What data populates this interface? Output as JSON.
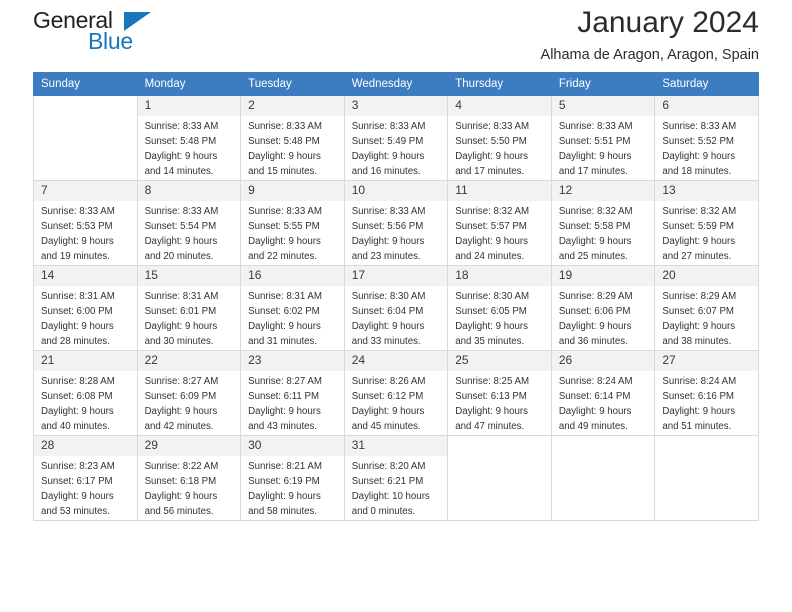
{
  "brand": {
    "name_part1": "General",
    "name_part2": "Blue",
    "accent_color": "#1b75bb",
    "flag_icon": "triangle-flag-icon"
  },
  "header": {
    "month_title": "January 2024",
    "location": "Alhama de Aragon, Aragon, Spain"
  },
  "calendar": {
    "header_bg": "#3b7dc0",
    "daynum_bg": "#f2f2f2",
    "weekday_headers": [
      "Sunday",
      "Monday",
      "Tuesday",
      "Wednesday",
      "Thursday",
      "Friday",
      "Saturday"
    ],
    "weeks": [
      [
        {
          "day": "",
          "empty": true,
          "sunrise": "",
          "sunset": "",
          "daylight_1": "",
          "daylight_2": ""
        },
        {
          "day": "1",
          "sunrise": "Sunrise: 8:33 AM",
          "sunset": "Sunset: 5:48 PM",
          "daylight_1": "Daylight: 9 hours",
          "daylight_2": "and 14 minutes."
        },
        {
          "day": "2",
          "sunrise": "Sunrise: 8:33 AM",
          "sunset": "Sunset: 5:48 PM",
          "daylight_1": "Daylight: 9 hours",
          "daylight_2": "and 15 minutes."
        },
        {
          "day": "3",
          "sunrise": "Sunrise: 8:33 AM",
          "sunset": "Sunset: 5:49 PM",
          "daylight_1": "Daylight: 9 hours",
          "daylight_2": "and 16 minutes."
        },
        {
          "day": "4",
          "sunrise": "Sunrise: 8:33 AM",
          "sunset": "Sunset: 5:50 PM",
          "daylight_1": "Daylight: 9 hours",
          "daylight_2": "and 17 minutes."
        },
        {
          "day": "5",
          "sunrise": "Sunrise: 8:33 AM",
          "sunset": "Sunset: 5:51 PM",
          "daylight_1": "Daylight: 9 hours",
          "daylight_2": "and 17 minutes."
        },
        {
          "day": "6",
          "sunrise": "Sunrise: 8:33 AM",
          "sunset": "Sunset: 5:52 PM",
          "daylight_1": "Daylight: 9 hours",
          "daylight_2": "and 18 minutes."
        }
      ],
      [
        {
          "day": "7",
          "sunrise": "Sunrise: 8:33 AM",
          "sunset": "Sunset: 5:53 PM",
          "daylight_1": "Daylight: 9 hours",
          "daylight_2": "and 19 minutes."
        },
        {
          "day": "8",
          "sunrise": "Sunrise: 8:33 AM",
          "sunset": "Sunset: 5:54 PM",
          "daylight_1": "Daylight: 9 hours",
          "daylight_2": "and 20 minutes."
        },
        {
          "day": "9",
          "sunrise": "Sunrise: 8:33 AM",
          "sunset": "Sunset: 5:55 PM",
          "daylight_1": "Daylight: 9 hours",
          "daylight_2": "and 22 minutes."
        },
        {
          "day": "10",
          "sunrise": "Sunrise: 8:33 AM",
          "sunset": "Sunset: 5:56 PM",
          "daylight_1": "Daylight: 9 hours",
          "daylight_2": "and 23 minutes."
        },
        {
          "day": "11",
          "sunrise": "Sunrise: 8:32 AM",
          "sunset": "Sunset: 5:57 PM",
          "daylight_1": "Daylight: 9 hours",
          "daylight_2": "and 24 minutes."
        },
        {
          "day": "12",
          "sunrise": "Sunrise: 8:32 AM",
          "sunset": "Sunset: 5:58 PM",
          "daylight_1": "Daylight: 9 hours",
          "daylight_2": "and 25 minutes."
        },
        {
          "day": "13",
          "sunrise": "Sunrise: 8:32 AM",
          "sunset": "Sunset: 5:59 PM",
          "daylight_1": "Daylight: 9 hours",
          "daylight_2": "and 27 minutes."
        }
      ],
      [
        {
          "day": "14",
          "sunrise": "Sunrise: 8:31 AM",
          "sunset": "Sunset: 6:00 PM",
          "daylight_1": "Daylight: 9 hours",
          "daylight_2": "and 28 minutes."
        },
        {
          "day": "15",
          "sunrise": "Sunrise: 8:31 AM",
          "sunset": "Sunset: 6:01 PM",
          "daylight_1": "Daylight: 9 hours",
          "daylight_2": "and 30 minutes."
        },
        {
          "day": "16",
          "sunrise": "Sunrise: 8:31 AM",
          "sunset": "Sunset: 6:02 PM",
          "daylight_1": "Daylight: 9 hours",
          "daylight_2": "and 31 minutes."
        },
        {
          "day": "17",
          "sunrise": "Sunrise: 8:30 AM",
          "sunset": "Sunset: 6:04 PM",
          "daylight_1": "Daylight: 9 hours",
          "daylight_2": "and 33 minutes."
        },
        {
          "day": "18",
          "sunrise": "Sunrise: 8:30 AM",
          "sunset": "Sunset: 6:05 PM",
          "daylight_1": "Daylight: 9 hours",
          "daylight_2": "and 35 minutes."
        },
        {
          "day": "19",
          "sunrise": "Sunrise: 8:29 AM",
          "sunset": "Sunset: 6:06 PM",
          "daylight_1": "Daylight: 9 hours",
          "daylight_2": "and 36 minutes."
        },
        {
          "day": "20",
          "sunrise": "Sunrise: 8:29 AM",
          "sunset": "Sunset: 6:07 PM",
          "daylight_1": "Daylight: 9 hours",
          "daylight_2": "and 38 minutes."
        }
      ],
      [
        {
          "day": "21",
          "sunrise": "Sunrise: 8:28 AM",
          "sunset": "Sunset: 6:08 PM",
          "daylight_1": "Daylight: 9 hours",
          "daylight_2": "and 40 minutes."
        },
        {
          "day": "22",
          "sunrise": "Sunrise: 8:27 AM",
          "sunset": "Sunset: 6:09 PM",
          "daylight_1": "Daylight: 9 hours",
          "daylight_2": "and 42 minutes."
        },
        {
          "day": "23",
          "sunrise": "Sunrise: 8:27 AM",
          "sunset": "Sunset: 6:11 PM",
          "daylight_1": "Daylight: 9 hours",
          "daylight_2": "and 43 minutes."
        },
        {
          "day": "24",
          "sunrise": "Sunrise: 8:26 AM",
          "sunset": "Sunset: 6:12 PM",
          "daylight_1": "Daylight: 9 hours",
          "daylight_2": "and 45 minutes."
        },
        {
          "day": "25",
          "sunrise": "Sunrise: 8:25 AM",
          "sunset": "Sunset: 6:13 PM",
          "daylight_1": "Daylight: 9 hours",
          "daylight_2": "and 47 minutes."
        },
        {
          "day": "26",
          "sunrise": "Sunrise: 8:24 AM",
          "sunset": "Sunset: 6:14 PM",
          "daylight_1": "Daylight: 9 hours",
          "daylight_2": "and 49 minutes."
        },
        {
          "day": "27",
          "sunrise": "Sunrise: 8:24 AM",
          "sunset": "Sunset: 6:16 PM",
          "daylight_1": "Daylight: 9 hours",
          "daylight_2": "and 51 minutes."
        }
      ],
      [
        {
          "day": "28",
          "sunrise": "Sunrise: 8:23 AM",
          "sunset": "Sunset: 6:17 PM",
          "daylight_1": "Daylight: 9 hours",
          "daylight_2": "and 53 minutes."
        },
        {
          "day": "29",
          "sunrise": "Sunrise: 8:22 AM",
          "sunset": "Sunset: 6:18 PM",
          "daylight_1": "Daylight: 9 hours",
          "daylight_2": "and 56 minutes."
        },
        {
          "day": "30",
          "sunrise": "Sunrise: 8:21 AM",
          "sunset": "Sunset: 6:19 PM",
          "daylight_1": "Daylight: 9 hours",
          "daylight_2": "and 58 minutes."
        },
        {
          "day": "31",
          "sunrise": "Sunrise: 8:20 AM",
          "sunset": "Sunset: 6:21 PM",
          "daylight_1": "Daylight: 10 hours",
          "daylight_2": "and 0 minutes."
        },
        {
          "day": "",
          "empty": true,
          "sunrise": "",
          "sunset": "",
          "daylight_1": "",
          "daylight_2": ""
        },
        {
          "day": "",
          "empty": true,
          "sunrise": "",
          "sunset": "",
          "daylight_1": "",
          "daylight_2": ""
        },
        {
          "day": "",
          "empty": true,
          "sunrise": "",
          "sunset": "",
          "daylight_1": "",
          "daylight_2": ""
        }
      ]
    ]
  }
}
